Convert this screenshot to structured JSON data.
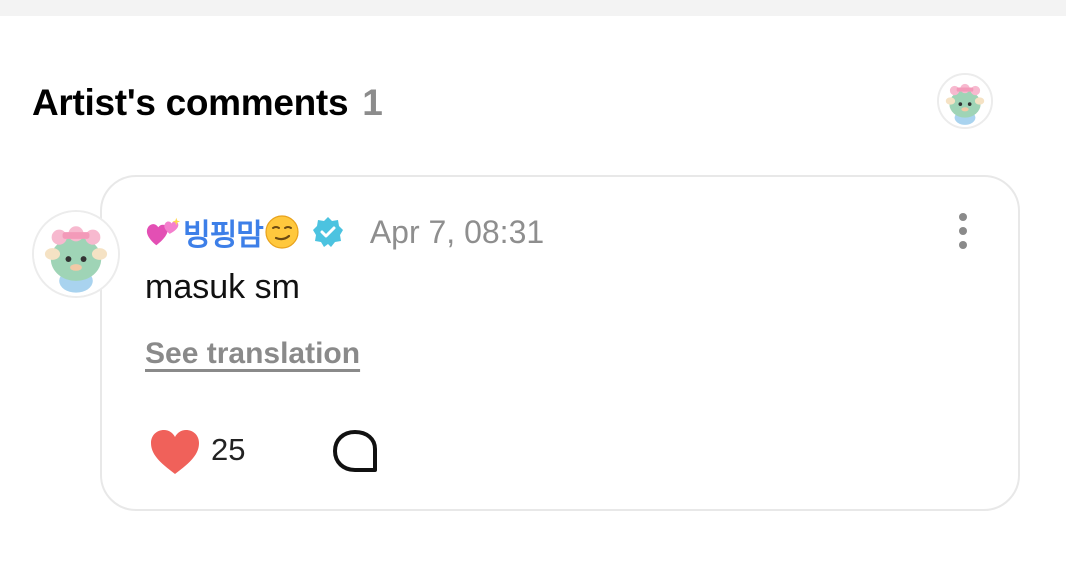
{
  "section": {
    "title": "Artist's comments",
    "count": "1"
  },
  "comment": {
    "author_prefix_icon": "sparkling-hearts-emoji",
    "author_name": "빙핑맘",
    "author_suffix_icon": "smirking-face-emoji",
    "verified_icon": "verified-badge-icon",
    "timestamp": "Apr 7, 08:31",
    "body": "masuk sm",
    "translate_label": "See translation",
    "like_count": "25",
    "like_icon": "heart-icon",
    "reply_icon": "speech-bubble-icon",
    "more_icon": "vertical-ellipsis-icon"
  },
  "colors": {
    "author_name": "#3d7fe8",
    "verified": "#4cc3e0",
    "heart": "#f0615a",
    "muted_text": "#8e8e8e"
  }
}
